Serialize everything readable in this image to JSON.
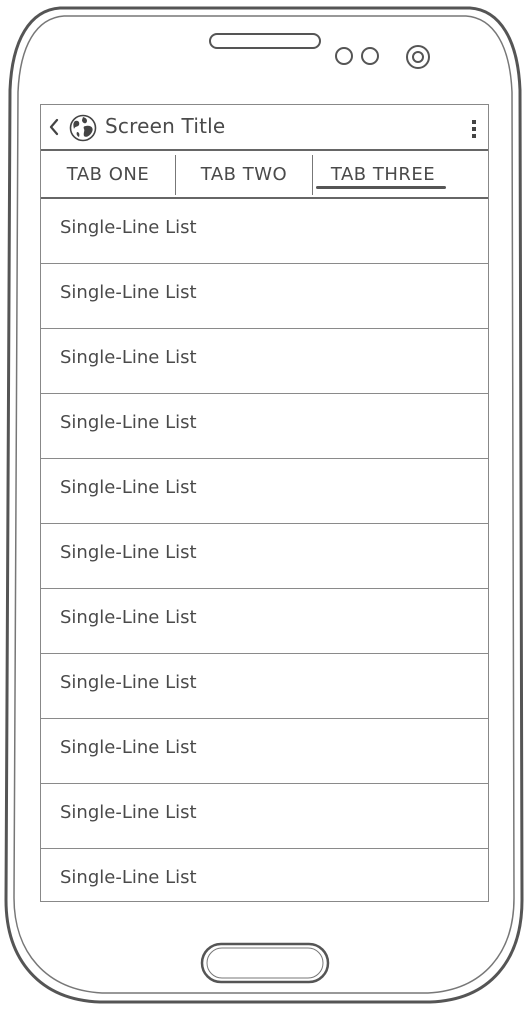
{
  "header": {
    "title": "Screen Title"
  },
  "tabs": [
    {
      "label": "TAB ONE",
      "selected": false
    },
    {
      "label": "TAB TWO",
      "selected": false
    },
    {
      "label": "TAB THREE",
      "selected": true
    }
  ],
  "list": {
    "items": [
      {
        "label": "Single-Line List"
      },
      {
        "label": "Single-Line List"
      },
      {
        "label": "Single-Line List"
      },
      {
        "label": "Single-Line List"
      },
      {
        "label": "Single-Line List"
      },
      {
        "label": "Single-Line List"
      },
      {
        "label": "Single-Line List"
      },
      {
        "label": "Single-Line List"
      },
      {
        "label": "Single-Line List"
      },
      {
        "label": "Single-Line List"
      },
      {
        "label": "Single-Line List"
      }
    ]
  },
  "icons": {
    "back": "chevron-left-icon",
    "globe": "globe-icon",
    "menu": "kebab-menu-icon",
    "camera": "camera-icon",
    "sensor": "sensor-icon",
    "speaker": "speaker-grille-icon",
    "home": "home-button-icon"
  },
  "colors": {
    "outline": "#555555",
    "divider": "#8a8a8a",
    "text": "#4a4a4a"
  }
}
